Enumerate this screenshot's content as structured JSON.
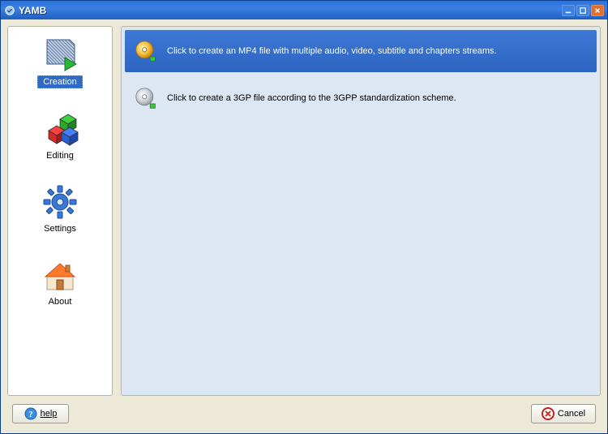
{
  "window": {
    "title": "YAMB"
  },
  "sidebar": {
    "items": [
      {
        "label": "Creation",
        "icon": "creation-icon",
        "selected": true
      },
      {
        "label": "Editing",
        "icon": "cubes-icon",
        "selected": false
      },
      {
        "label": "Settings",
        "icon": "gear-icon",
        "selected": false
      },
      {
        "label": "About",
        "icon": "house-icon",
        "selected": false
      }
    ]
  },
  "content": {
    "options": [
      {
        "label": "Click to create an MP4 file with multiple audio, video, subtitle and chapters streams.",
        "icon": "disc-gold-icon",
        "selected": true
      },
      {
        "label": "Click to create a 3GP file according to the 3GPP standardization scheme.",
        "icon": "disc-silver-icon",
        "selected": false
      }
    ]
  },
  "buttons": {
    "help": "help",
    "cancel": "Cancel"
  }
}
